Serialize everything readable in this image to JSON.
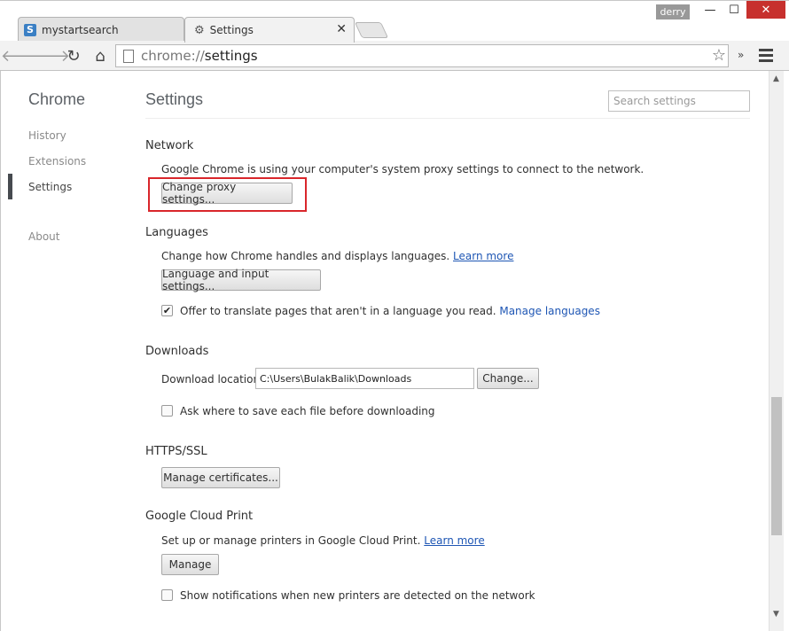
{
  "window": {
    "profile": "derry",
    "min_icon": "—",
    "max_icon": "☐",
    "close_icon": "✕"
  },
  "tabs": [
    {
      "label": "mystartsearch",
      "favicon": "S"
    },
    {
      "label": "Settings"
    }
  ],
  "toolbar": {
    "url_scheme": "chrome://",
    "url_path": "settings"
  },
  "sidebar": {
    "title": "Chrome",
    "items": [
      {
        "label": "History"
      },
      {
        "label": "Extensions"
      },
      {
        "label": "Settings",
        "selected": true
      },
      {
        "label": "About"
      }
    ]
  },
  "header": {
    "title": "Settings",
    "search_placeholder": "Search settings"
  },
  "network": {
    "title": "Network",
    "description": "Google Chrome is using your computer's system proxy settings to connect to the network.",
    "button": "Change proxy settings..."
  },
  "languages": {
    "title": "Languages",
    "description": "Change how Chrome handles and displays languages.",
    "learn_more": "Learn more",
    "button": "Language and input settings...",
    "translate_label": "Offer to translate pages that aren't in a language you read.",
    "translate_checked": true,
    "manage_link": "Manage languages"
  },
  "downloads": {
    "title": "Downloads",
    "location_label": "Download location:",
    "location_value": "C:\\Users\\BulakBalik\\Downloads",
    "change_button": "Change...",
    "ask_label": "Ask where to save each file before downloading",
    "ask_checked": false
  },
  "https": {
    "title": "HTTPS/SSL",
    "button": "Manage certificates..."
  },
  "cloud_print": {
    "title": "Google Cloud Print",
    "description": "Set up or manage printers in Google Cloud Print.",
    "learn_more": "Learn more",
    "button": "Manage",
    "notify_label": "Show notifications when new printers are detected on the network",
    "notify_checked": false
  },
  "colors": {
    "link": "#1e56b4",
    "highlight": "#d9262b",
    "close_button": "#c7302d"
  }
}
